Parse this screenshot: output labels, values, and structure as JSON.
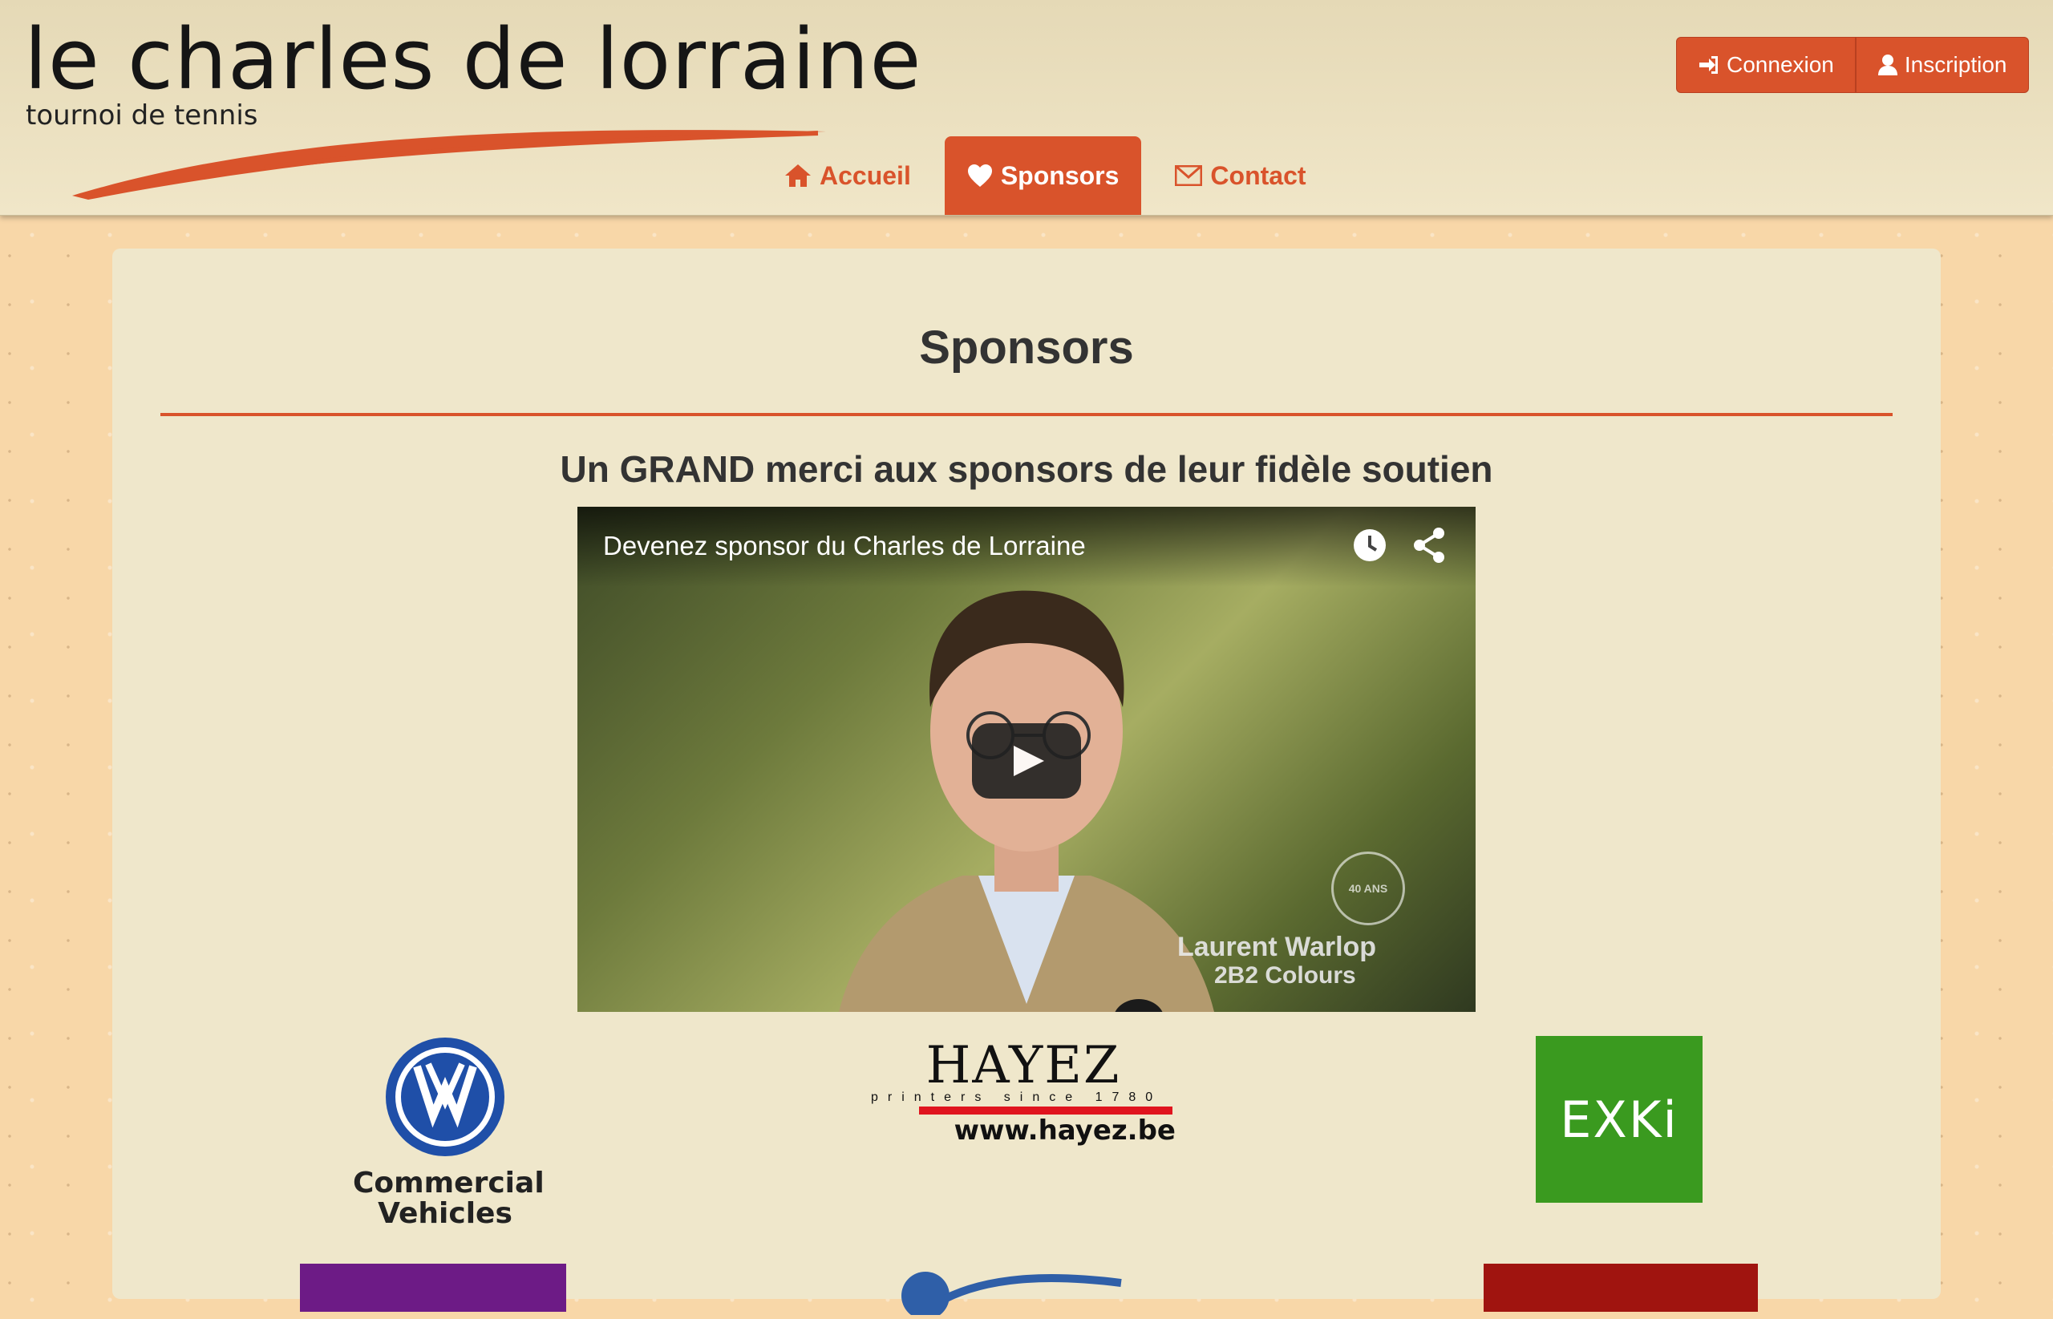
{
  "brand": {
    "title": "le charles de lorraine",
    "subtitle": "tournoi de tennis"
  },
  "auth": {
    "login_label": "Connexion",
    "register_label": "Inscription"
  },
  "nav": {
    "items": [
      {
        "label": "Accueil",
        "icon": "home-icon",
        "active": false
      },
      {
        "label": "Sponsors",
        "icon": "heart-icon",
        "active": true
      },
      {
        "label": "Contact",
        "icon": "envelope-icon",
        "active": false
      }
    ]
  },
  "page": {
    "title": "Sponsors",
    "subtitle": "Un GRAND merci aux sponsors de leur fidèle soutien"
  },
  "video": {
    "title": "Devenez sponsor du Charles de Lorraine",
    "caption_name": "Laurent Warlop",
    "caption_company": "2B2 Colours",
    "badge": "40 ANS"
  },
  "sponsors": {
    "vw_line1": "Commercial",
    "vw_line2": "Vehicles",
    "hayez_name": "HAYEZ",
    "hayez_tagline": "printers since 1780",
    "hayez_url": "www.hayez.be",
    "exki_name": "EXKi"
  },
  "colors": {
    "accent": "#d9532b",
    "panel": "#efe7cb",
    "background": "#f8d7a8",
    "exki_green": "#3a9a1f",
    "vw_blue": "#1f4fa8"
  }
}
